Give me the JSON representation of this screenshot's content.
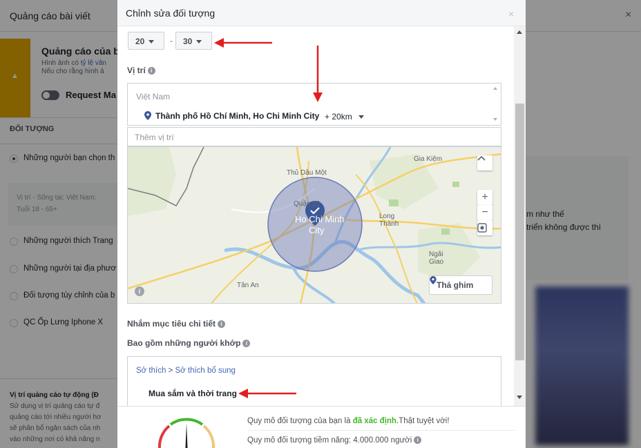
{
  "background": {
    "header_title": "Quảng cáo bài viết",
    "close_glyph": "×",
    "warning": {
      "title": "Quảng cáo của b",
      "line1_prefix": "Hình ảnh có ",
      "line1_link": "tỷ lệ văn",
      "line2": "Nếu cho rằng hình ả",
      "icon_glyph": "▲",
      "toggle_label": "Request Ma"
    },
    "section_title": "ĐỐI TƯỢNG",
    "audience_options": [
      "Những người bạn chọn th",
      "Những người thích Trang",
      "Những người tại địa phươ",
      "Đối tượng tùy chỉnh của b",
      "QC Ốp Lưng Iphone X"
    ],
    "location_summary": "Vị trí - Sống tại: Việt Nam:",
    "age_summary": "Tuổi 18 - 65+",
    "auto_placement_title": "Vị trí quảng cáo tự động (Đ",
    "auto_placement_lines": [
      "Sử dụng vị trí quảng cáo tự đ",
      "quảng cáo tới nhiều người hơ",
      "sẽ phân bổ ngân sách của nh",
      "vào những nơi có khả năng n"
    ],
    "right_text_1": "m như thế",
    "right_text_2": "triển không được thì"
  },
  "modal": {
    "title": "Chỉnh sửa đối tượng",
    "close_glyph": "×",
    "age_min": "20",
    "age_max": "30",
    "age_separator": "-",
    "location_label": "Vị trí",
    "location_country": "Việt Nam",
    "location_city": "Thành phố Hồ Chí Minh, Ho Chi Minh City",
    "location_radius": "+ 20km",
    "add_location_placeholder": "Thêm vị trí",
    "map": {
      "drop_pin_label": "Thả ghim",
      "zoom_in": "+",
      "zoom_out": "−",
      "labels": {
        "thu_dau_mot": "Thủ Dầu Một",
        "gia_kiem": "Gia Kiệm",
        "quan_12": "Quận 12",
        "ho_chi_minh": "Ho Chi Minh",
        "city": "City",
        "long_thanh_1": "Long",
        "long_thanh_2": "Thành",
        "ngai_giao_1": "Ngãi",
        "ngai_giao_2": "Giao",
        "tan_an": "Tân An"
      }
    },
    "detailed_targeting_label": "Nhắm mục tiêu chi tiết",
    "include_label": "Bao gồm những người khớp",
    "interest_path": {
      "root": "Sở thích",
      "separator": ">",
      "child": "Sở thích bổ sung"
    },
    "interest_item": "Mua sắm và thời trang",
    "footer": {
      "line1_prefix": "Quy mô đối tượng của bạn là ",
      "line1_status": "đã xác định",
      "line1_suffix": ".Thật tuyệt vời!",
      "line2": "Quy mô đối tượng tiềm năng: 4.000.000 người"
    }
  },
  "colors": {
    "annotation_arrow": "#e02020",
    "warning": "#e2a500",
    "link": "#4267b2",
    "good": "#42b72a",
    "pin": "#3b5998"
  }
}
